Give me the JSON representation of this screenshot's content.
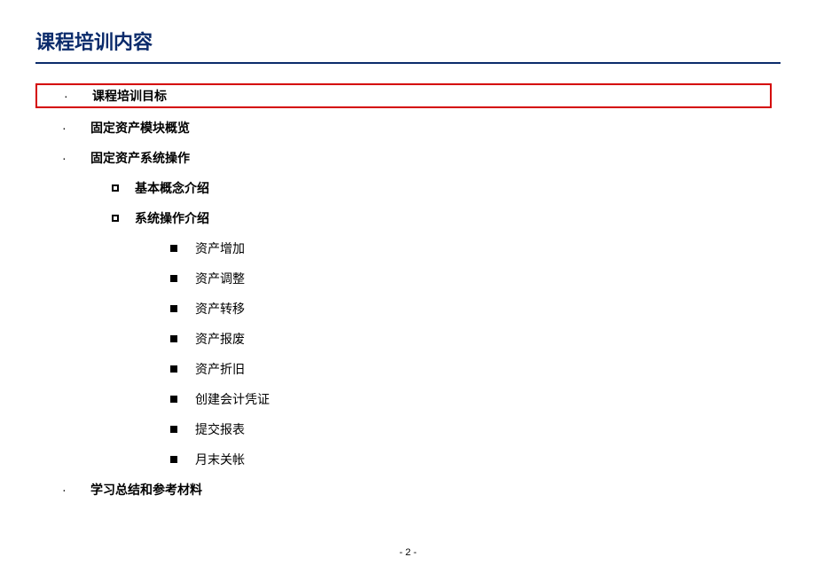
{
  "title": "课程培训内容",
  "items": {
    "i1": "课程培训目标",
    "i2": "固定资产模块概览",
    "i3": "固定资产系统操作",
    "i3a": "基本概念介绍",
    "i3b": "系统操作介绍",
    "i3b1": "资产增加",
    "i3b2": "资产调整",
    "i3b3": "资产转移",
    "i3b4": "资产报废",
    "i3b5": "资产折旧",
    "i3b6": "创建会计凭证",
    "i3b7": "提交报表",
    "i3b8": "月末关帐",
    "i4": "学习总结和参考材料"
  },
  "pageNumber": "- 2 -"
}
